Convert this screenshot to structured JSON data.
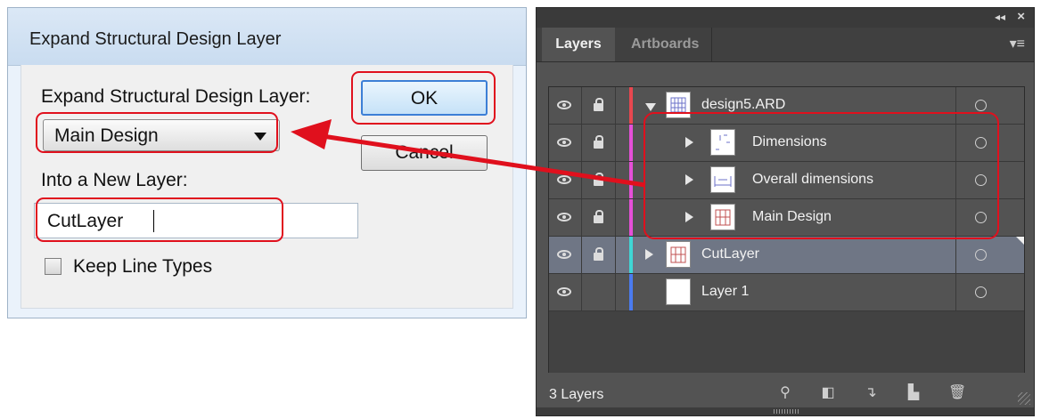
{
  "dialog": {
    "title": "Expand Structural Design Layer",
    "expand_label": "Expand Structural Design Layer:",
    "selected_layer": "Main Design",
    "into_label": "Into a New Layer:",
    "new_layer_value": "CutLayer",
    "keep_line_types_label": "Keep Line Types",
    "keep_line_types_checked": false,
    "ok_label": "OK",
    "cancel_label": "Cancel"
  },
  "panel": {
    "tabs": [
      "Layers",
      "Artboards"
    ],
    "active_tab": "Layers",
    "layers": [
      {
        "name": "design5.ARD",
        "color": "#e8474f",
        "expanded": true,
        "locked": true,
        "visible": true
      },
      {
        "name": "Dimensions",
        "color": "#e64fd8",
        "sublayer": true,
        "locked": true,
        "visible": true
      },
      {
        "name": "Overall dimensions",
        "color": "#e64fd8",
        "sublayer": true,
        "locked": true,
        "visible": true
      },
      {
        "name": "Main Design",
        "color": "#e64fd8",
        "sublayer": true,
        "locked": true,
        "visible": true
      },
      {
        "name": "CutLayer",
        "color": "#3fd6d6",
        "selected": true,
        "locked": true,
        "visible": true
      },
      {
        "name": "Layer 1",
        "color": "#4a7bf0",
        "locked": false,
        "visible": true
      }
    ],
    "layer_count": "3 Layers"
  },
  "annotation": {
    "highlight_color": "#e0101d"
  }
}
